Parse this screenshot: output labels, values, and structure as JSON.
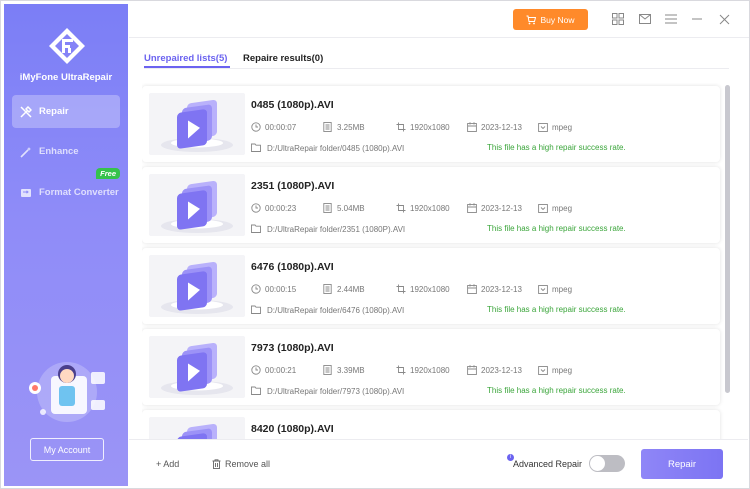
{
  "app": {
    "name": "iMyFone UltraRepair"
  },
  "sidebar": {
    "items": [
      {
        "label": "Repair",
        "icon": "repair-tools-icon",
        "active": true
      },
      {
        "label": "Enhance",
        "icon": "magic-wand-icon",
        "active": false
      },
      {
        "label": "Format Converter",
        "icon": "converter-icon",
        "active": false,
        "badge": "Free"
      }
    ],
    "account_label": "My Account"
  },
  "topbar": {
    "buy_label": "Buy Now",
    "icons": [
      "grid-icon",
      "mail-icon",
      "menu-icon",
      "minimize-icon",
      "close-icon"
    ]
  },
  "tabs": [
    {
      "label": "Unrepaired lists(5)",
      "active": true
    },
    {
      "label": "Repaire results(0)",
      "active": false
    }
  ],
  "files": [
    {
      "name": "0485 (1080p).AVI",
      "duration": "00:00:07",
      "size": "3.25MB",
      "resolution": "1920x1080",
      "date": "2023-12-13",
      "format": "mpeg",
      "path": "D:/UltraRepair folder/0485 (1080p).AVI",
      "status": "This file has a high repair success rate."
    },
    {
      "name": "2351 (1080P).AVI",
      "duration": "00:00:23",
      "size": "5.04MB",
      "resolution": "1920x1080",
      "date": "2023-12-13",
      "format": "mpeg",
      "path": "D:/UltraRepair folder/2351 (1080P).AVI",
      "status": "This file has a high repair success rate."
    },
    {
      "name": "6476 (1080p).AVI",
      "duration": "00:00:15",
      "size": "2.44MB",
      "resolution": "1920x1080",
      "date": "2023-12-13",
      "format": "mpeg",
      "path": "D:/UltraRepair folder/6476 (1080p).AVI",
      "status": "This file has a high repair success rate."
    },
    {
      "name": "7973 (1080p).AVI",
      "duration": "00:00:21",
      "size": "3.39MB",
      "resolution": "1920x1080",
      "date": "2023-12-13",
      "format": "mpeg",
      "path": "D:/UltraRepair folder/7973 (1080p).AVI",
      "status": "This file has a high repair success rate."
    },
    {
      "name": "8420 (1080p).AVI"
    }
  ],
  "bottom": {
    "add_label": "+ Add",
    "remove_label": "Remove all",
    "advanced_label": "Advanced Repair",
    "advanced_enabled": false,
    "repair_label": "Repair"
  },
  "colors": {
    "accent": "#6b63f0",
    "buy": "#ff8a2a",
    "success": "#3aa53a",
    "sidebar_top": "#7b7ef6",
    "sidebar_bottom": "#9b94f6"
  }
}
